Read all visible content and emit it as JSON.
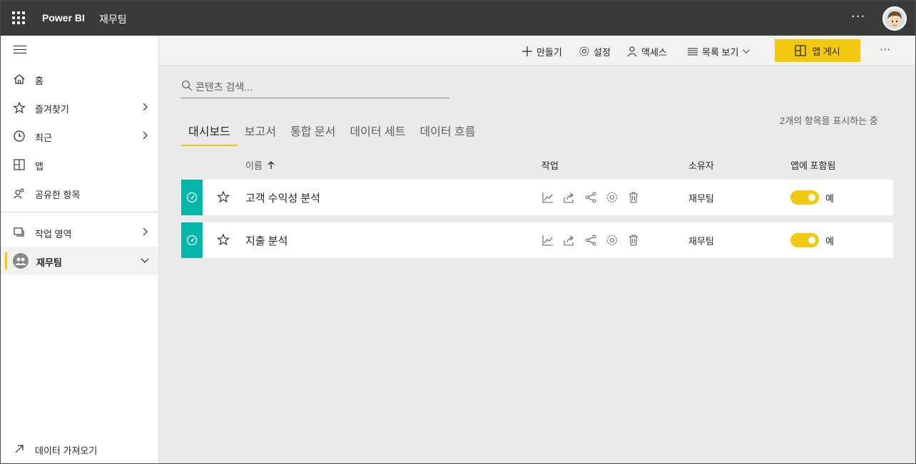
{
  "header": {
    "brand": "Power BI",
    "workspace": "재무팀",
    "more": "···"
  },
  "sidebar": {
    "items": [
      {
        "label": "홈",
        "icon": "home-icon"
      },
      {
        "label": "즐겨찾기",
        "icon": "star-icon"
      },
      {
        "label": "최근",
        "icon": "clock-icon"
      },
      {
        "label": "앱",
        "icon": "apps-icon"
      },
      {
        "label": "공유한 항목",
        "icon": "shared-icon"
      },
      {
        "label": "작업 영역",
        "icon": "workspaces-icon"
      },
      {
        "label": "재무팀",
        "icon": "workspace-avatar-icon"
      }
    ],
    "get_data": "데이터 가져오기"
  },
  "actionbar": {
    "create": "만들기",
    "settings": "설정",
    "access": "액세스",
    "view": "목록 보기",
    "publish": "앱 게시",
    "more": "···"
  },
  "search": {
    "placeholder": "콘텐츠 검색..."
  },
  "tabs": [
    "대시보드",
    "보고서",
    "통합 문서",
    "데이터 세트",
    "데이터 흐름"
  ],
  "count_text": "2개의 항목을 표시하는 중",
  "table": {
    "headers": {
      "name": "이름",
      "actions": "작업",
      "owner": "소유자",
      "included": "앱에 포함됨"
    },
    "rows": [
      {
        "name": "고객 수익성 분석",
        "owner": "재무팀",
        "included": "예"
      },
      {
        "name": "지출 분석",
        "owner": "재무팀",
        "included": "예"
      }
    ]
  },
  "colors": {
    "accent": "#f2c811",
    "dashboard_tile": "#00b7a8",
    "topbar": "#3b3a39"
  }
}
